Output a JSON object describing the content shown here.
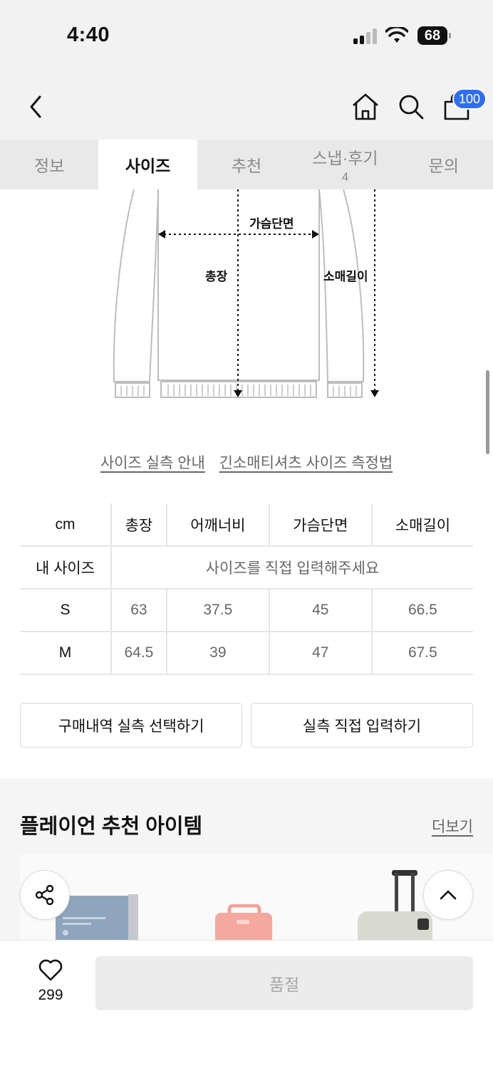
{
  "status_bar": {
    "time": "4:40",
    "battery": "68"
  },
  "header": {
    "cart_badge": "100"
  },
  "tabs": [
    {
      "label": "정보",
      "count": ""
    },
    {
      "label": "사이즈",
      "count": ""
    },
    {
      "label": "추천",
      "count": ""
    },
    {
      "label": "스냅·후기",
      "count": "4"
    },
    {
      "label": "문의",
      "count": ""
    }
  ],
  "active_tab": "사이즈",
  "diagram": {
    "chest_label": "가슴단면",
    "length_label": "총장",
    "sleeve_label": "소매길이"
  },
  "links": {
    "size_guide": "사이즈 실측 안내",
    "measure_method": "긴소매티셔츠 사이즈 측정법"
  },
  "size_table": {
    "headers": [
      "cm",
      "총장",
      "어깨너비",
      "가슴단면",
      "소매길이"
    ],
    "my_size_label": "내 사이즈",
    "my_size_prompt": "사이즈를 직접 입력해주세요",
    "rows": [
      {
        "size": "S",
        "values": [
          "63",
          "37.5",
          "45",
          "66.5"
        ]
      },
      {
        "size": "M",
        "values": [
          "64.5",
          "39",
          "47",
          "67.5"
        ]
      }
    ]
  },
  "buttons": {
    "select_from_history": "구매내역 실측 선택하기",
    "enter_manually": "실측 직접 입력하기"
  },
  "recommend": {
    "title": "플레이언 추천 아이템",
    "more": "더보기"
  },
  "bottom": {
    "like_count": "299",
    "buy_label": "품절"
  },
  "colors": {
    "accent_badge": "#2f6df6",
    "tab_bg": "#e9e9e9",
    "header_bg": "#f2f2f2"
  }
}
